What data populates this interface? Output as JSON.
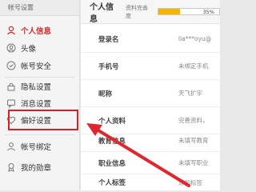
{
  "sidebar": {
    "header": "帐号设置",
    "items": [
      {
        "label": "个人信息",
        "icon": "user-info-icon"
      },
      {
        "label": "头像",
        "icon": "avatar-icon"
      },
      {
        "label": "帐号安全",
        "icon": "shield-icon"
      },
      {
        "label": "隐私设置",
        "icon": "lock-icon"
      },
      {
        "label": "消息设置",
        "icon": "message-icon"
      },
      {
        "label": "偏好设置",
        "icon": "heart-icon"
      },
      {
        "label": "帐号绑定",
        "icon": "bind-icon"
      },
      {
        "label": "我的勋章",
        "icon": "medal-icon"
      }
    ]
  },
  "main": {
    "title": "个人信息",
    "progress_label": "资料完善度",
    "progress_value": 35,
    "progress_text": "35%",
    "rows": [
      {
        "label": "登录名",
        "value": "lia***oyu@"
      },
      {
        "label": "手机号",
        "value": "未绑定手机"
      },
      {
        "label": "昵称",
        "value": "天飞扩宇"
      },
      {
        "label": "个人资料",
        "value": "完善资料，"
      },
      {
        "label": "教育信息",
        "value": "未填写教育"
      },
      {
        "label": "职业信息",
        "value": "未填写职业"
      },
      {
        "label": "个人标签",
        "value": "添加标签"
      }
    ]
  },
  "colors": {
    "accent": "#d12a2a",
    "progress": "#f5b400",
    "highlight": "#d8202a"
  }
}
